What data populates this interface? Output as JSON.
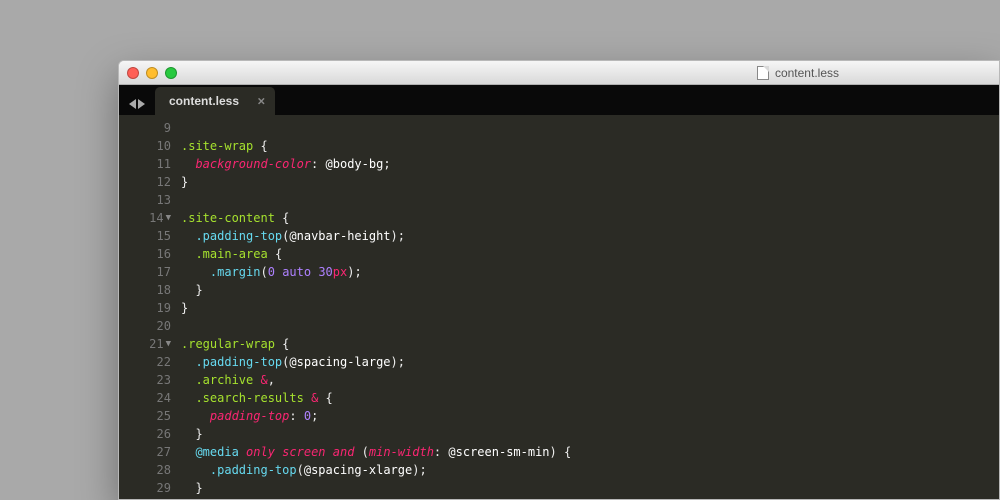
{
  "window": {
    "titlebar_filename": "content.less"
  },
  "tabs": {
    "nav_back_label": "back",
    "nav_fwd_label": "forward",
    "active_tab_label": "content.less",
    "close_glyph": "×"
  },
  "code": {
    "lines": [
      {
        "n": 9,
        "fold": "",
        "html": ""
      },
      {
        "n": 10,
        "fold": "",
        "html": "<span class='sel'>.site-wrap</span> <span class='punct'>{</span>"
      },
      {
        "n": 11,
        "fold": "",
        "html": "  <span class='prop'>background-color</span><span class='punct'>:</span> <span class='varw'>@body-bg</span><span class='punct'>;</span>"
      },
      {
        "n": 12,
        "fold": "",
        "html": "<span class='punct'>}</span>"
      },
      {
        "n": 13,
        "fold": "",
        "html": ""
      },
      {
        "n": 14,
        "fold": "▼",
        "html": "<span class='sel'>.site-content</span> <span class='punct'>{</span>"
      },
      {
        "n": 15,
        "fold": "",
        "html": "  <span class='mixin'>.padding-top</span><span class='punct'>(</span><span class='varw'>@navbar-height</span><span class='punct'>);</span>"
      },
      {
        "n": 16,
        "fold": "",
        "html": "  <span class='sel'>.main-area</span> <span class='punct'>{</span>"
      },
      {
        "n": 17,
        "fold": "",
        "html": "    <span class='mixin'>.margin</span><span class='punct'>(</span><span class='num'>0</span> <span class='const'>auto</span> <span class='num'>30</span><span class='unit'>px</span><span class='punct'>);</span>"
      },
      {
        "n": 18,
        "fold": "",
        "html": "  <span class='punct'>}</span>"
      },
      {
        "n": 19,
        "fold": "",
        "html": "<span class='punct'>}</span>"
      },
      {
        "n": 20,
        "fold": "",
        "html": ""
      },
      {
        "n": 21,
        "fold": "▼",
        "html": "<span class='sel'>.regular-wrap</span> <span class='punct'>{</span>"
      },
      {
        "n": 22,
        "fold": "",
        "html": "  <span class='mixin'>.padding-top</span><span class='punct'>(</span><span class='varw'>@spacing-large</span><span class='punct'>);</span>"
      },
      {
        "n": 23,
        "fold": "",
        "html": "  <span class='sel'>.archive</span> <span class='amp'>&amp;</span><span class='punct'>,</span>"
      },
      {
        "n": 24,
        "fold": "",
        "html": "  <span class='sel'>.search-results</span> <span class='amp'>&amp;</span> <span class='punct'>{</span>"
      },
      {
        "n": 25,
        "fold": "",
        "html": "    <span class='prop'>padding-top</span><span class='punct'>:</span> <span class='num'>0</span><span class='punct'>;</span>"
      },
      {
        "n": 26,
        "fold": "",
        "html": "  <span class='punct'>}</span>"
      },
      {
        "n": 27,
        "fold": "",
        "html": "  <span class='kw'>@media</span> <span class='kwit'>only screen and</span> <span class='punct'>(</span><span class='prop'>min-width</span><span class='punct'>:</span> <span class='varw'>@screen-sm-min</span><span class='punct'>) {</span>"
      },
      {
        "n": 28,
        "fold": "",
        "html": "    <span class='mixin'>.padding-top</span><span class='punct'>(</span><span class='varw'>@spacing-xlarge</span><span class='punct'>);</span>"
      },
      {
        "n": 29,
        "fold": "",
        "html": "  <span class='punct'>}</span>"
      }
    ]
  }
}
